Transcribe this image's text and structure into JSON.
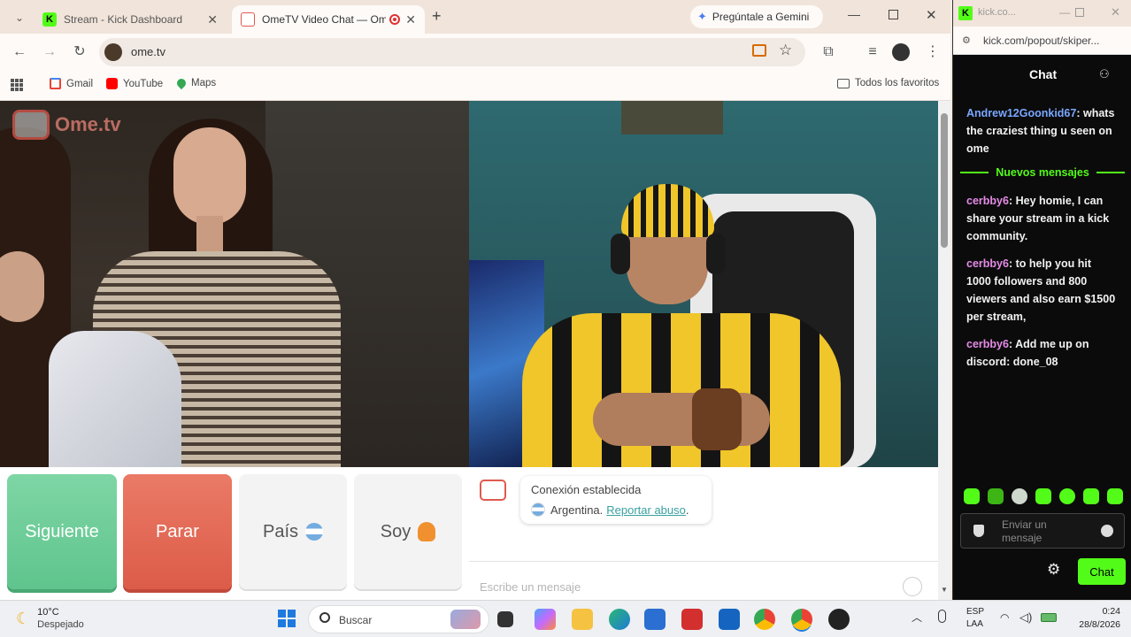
{
  "browser": {
    "tabs": [
      {
        "title": "Stream - Kick Dashboard",
        "favicon": "kick-icon",
        "color": "#53fc18",
        "active": false
      },
      {
        "title": "OmeTV Video Chat — Ome",
        "favicon": "ometv-icon",
        "color": "#e05a4f",
        "active": true
      }
    ],
    "new_tab": "+",
    "gemini": "Pregúntale a Gemini",
    "url": "ome.tv",
    "bookmarks": [
      {
        "label": "Gmail",
        "icon": "gmail-icon",
        "color": "#ea4335"
      },
      {
        "label": "YouTube",
        "icon": "youtube-icon",
        "color": "#ff0000"
      },
      {
        "label": "Maps",
        "icon": "maps-icon",
        "color": "#34a853"
      }
    ],
    "all_bookmarks": "Todos los favoritos"
  },
  "ometv": {
    "logo": "Ome.tv",
    "buttons": {
      "next": "Siguiente",
      "stop": "Parar",
      "country": "País",
      "gender": "Soy"
    },
    "status": {
      "connected": "Conexión establecida",
      "country": "Argentina.",
      "report": "Reportar abuso",
      "report_suffix": "."
    },
    "message_placeholder": "Escribe un mensaje",
    "colors": {
      "next": "#6ccf9a",
      "stop": "#e36a58",
      "accent": "#3aa0a0"
    }
  },
  "popout": {
    "window_title": "kick.co...",
    "url": "kick.com/popout/skiper...",
    "header": "Chat",
    "new_messages_label": "Nuevos mensajes",
    "messages": [
      {
        "user": "Andrew12Goonkid67",
        "color": "#7aa7ff",
        "text": "whats the craziest thing u seen on ome"
      },
      {
        "user": "cerbby6",
        "color": "#e58be6",
        "text": "Hey homie, I can share your stream in a kick community."
      },
      {
        "user": "cerbby6",
        "color": "#e58be6",
        "text": "to help you hit 1000 followers and 800 viewers and also earn $1500 per stream,"
      },
      {
        "user": "cerbby6",
        "color": "#e58be6",
        "text": "Add me up on discord: done_08"
      }
    ],
    "input_placeholder": "Enviar un mensaje",
    "send_button": "Chat",
    "accent": "#53fc18"
  },
  "taskbar": {
    "weather_temp": "10°C",
    "weather_text": "Despejado",
    "search_placeholder": "Buscar",
    "lang_top": "ESP",
    "lang_bottom": "LAA",
    "time": "0:24",
    "date": "28/8/2026"
  }
}
